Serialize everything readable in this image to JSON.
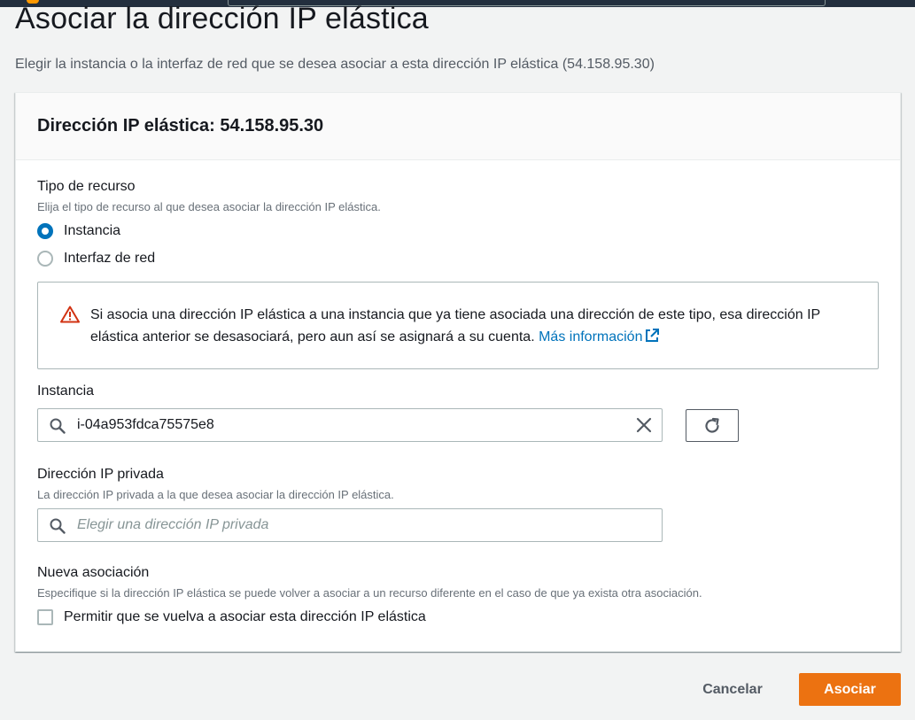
{
  "page": {
    "title": "Asociar la dirección IP elástica",
    "description": "Elegir la instancia o la interfaz de red que se desea asociar a esta dirección IP elástica (54.158.95.30)"
  },
  "panel": {
    "title": "Dirección IP elástica: 54.158.95.30"
  },
  "resource_type": {
    "label": "Tipo de recurso",
    "hint": "Elija el tipo de recurso al que desea asociar la dirección IP elástica.",
    "options": [
      {
        "label": "Instancia",
        "selected": true
      },
      {
        "label": "Interfaz de red",
        "selected": false
      }
    ]
  },
  "alert": {
    "icon": "warning-icon",
    "text": "Si asocia una dirección IP elástica a una instancia que ya tiene asociada una dirección de este tipo, esa dirección IP elástica anterior se desasociará, pero aun así se asignará a su cuenta.",
    "link_label": "Más información",
    "link_icon": "external-link-icon"
  },
  "instance": {
    "label": "Instancia",
    "value": "i-04a953fdca75575e8",
    "refresh_icon": "refresh-icon",
    "clear_icon": "close-icon"
  },
  "private_ip": {
    "label": "Dirección IP privada",
    "hint": "La dirección IP privada a la que desea asociar la dirección IP elástica.",
    "placeholder": "Elegir una dirección IP privada"
  },
  "reassociation": {
    "label": "Nueva asociación",
    "hint": "Especifique si la dirección IP elástica se puede volver a asociar a un recurso diferente en el caso de que ya exista otra asociación.",
    "checkbox_label": "Permitir que se vuelva a asociar esta dirección IP elástica",
    "checked": false
  },
  "actions": {
    "cancel_label": "Cancelar",
    "submit_label": "Asociar"
  },
  "colors": {
    "accent": "#0073bb",
    "primary_button": "#ec7211",
    "warning": "#d13212"
  }
}
